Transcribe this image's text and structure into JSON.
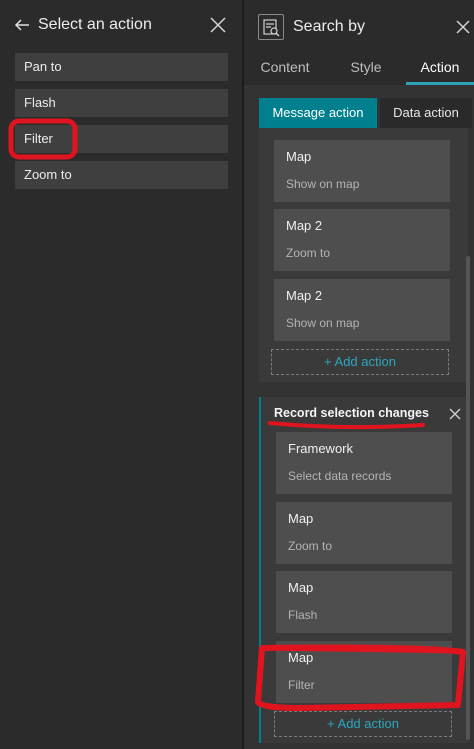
{
  "left_panel": {
    "title": "Select an action",
    "back_icon": "arrow-left-icon",
    "close_icon": "close-icon",
    "actions": [
      "Pan to",
      "Flash",
      "Filter",
      "Zoom to"
    ]
  },
  "right_panel": {
    "title": "Search by",
    "widget_icon": "search-widget-icon",
    "close_icon": "close-icon",
    "tabs": [
      {
        "label": "Content"
      },
      {
        "label": "Style"
      },
      {
        "label": "Action"
      }
    ],
    "subtabs": [
      "Message action",
      "Data action"
    ],
    "section1": {
      "cards": [
        {
          "title": "Map",
          "subtitle": "Show on map"
        },
        {
          "title": "Map 2",
          "subtitle": "Zoom to"
        },
        {
          "title": "Map 2",
          "subtitle": "Show on map"
        }
      ],
      "add_action": "+ Add action"
    },
    "section2": {
      "title": "Record selection changes",
      "cards": [
        {
          "title": "Framework",
          "subtitle": "Select data records"
        },
        {
          "title": "Map",
          "subtitle": "Zoom to"
        },
        {
          "title": "Map",
          "subtitle": "Flash"
        },
        {
          "title": "Map",
          "subtitle": "Filter"
        }
      ],
      "add_action": "+ Add action"
    }
  },
  "colors": {
    "accent": "#00808f",
    "accent_text": "#2aa6bd",
    "annotation": "#e0141e"
  }
}
